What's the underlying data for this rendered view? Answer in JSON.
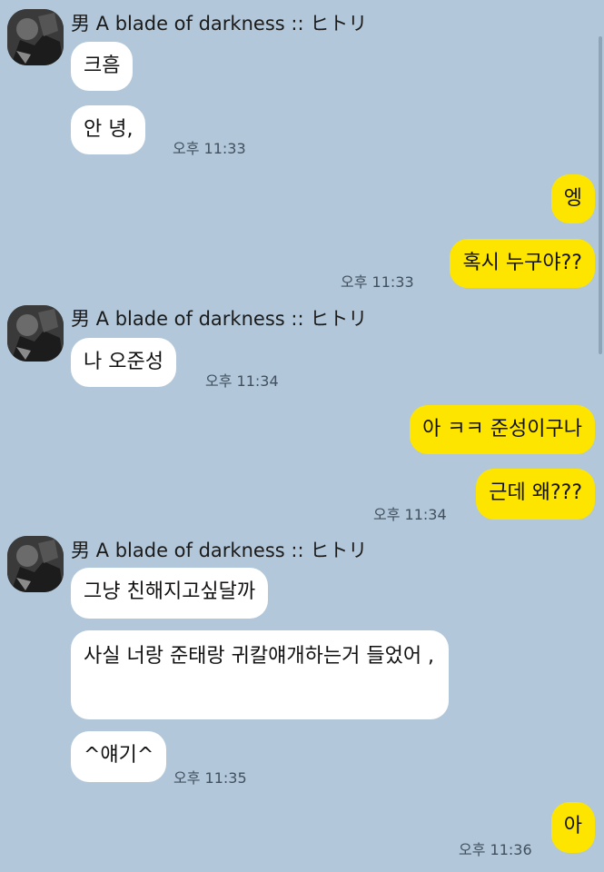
{
  "chat": {
    "sender_name": "男 A blade of darkness :: ヒトリ",
    "groups": [
      {
        "messages": [
          "크흠",
          "안 녕,"
        ],
        "time": "오후 11:33"
      },
      {
        "outgoing": true,
        "messages": [
          "엥",
          "혹시 누구야??"
        ],
        "time": "오후 11:33"
      },
      {
        "messages": [
          "나 오준성"
        ],
        "time": "오후 11:34"
      },
      {
        "outgoing": true,
        "messages": [
          "아 ㅋㅋ 준성이구나",
          "근데 왜???"
        ],
        "time": "오후 11:34"
      },
      {
        "messages": [
          "그냥 친해지고싶달까",
          "사실 너랑 준태랑 귀칼얘개하는거 들었어 ,",
          "^얘기^"
        ],
        "time": "오후 11:35"
      },
      {
        "outgoing": true,
        "messages": [
          "아"
        ],
        "time": "오후 11:36"
      }
    ]
  },
  "colors": {
    "background": "#b2c7d9",
    "outgoing_bubble": "#fee500",
    "incoming_bubble": "#ffffff"
  },
  "icons": {
    "avatar": "profile-avatar"
  }
}
